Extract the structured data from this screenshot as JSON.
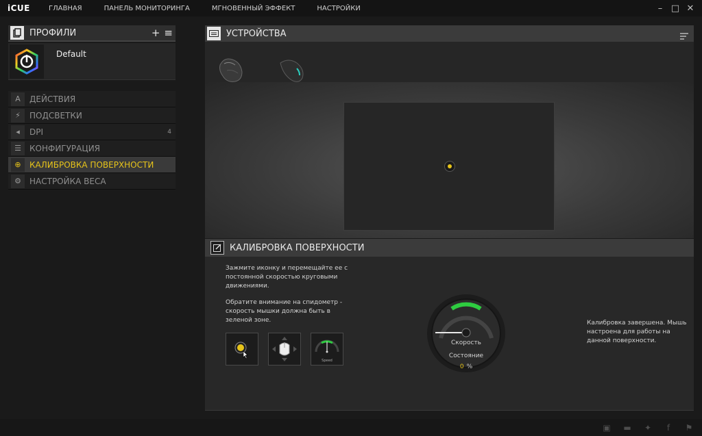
{
  "app": {
    "logo": "iCUE",
    "nav": [
      "ГЛАВНАЯ",
      "ПАНЕЛЬ МОНИТОРИНГА",
      "МГНОВЕННЫЙ ЭФФЕКТ",
      "НАСТРОЙКИ"
    ],
    "window_controls": [
      "minimize-icon",
      "maximize-icon",
      "close-icon"
    ]
  },
  "profiles": {
    "title": "ПРОФИЛИ",
    "add_label": "+",
    "menu_label": "≡",
    "current": {
      "name": "Default",
      "icon": "icue-logo-icon"
    }
  },
  "menu": [
    {
      "label": "ДЕЙСТВИЯ",
      "icon": "A",
      "badge": ""
    },
    {
      "label": "ПОДСВЕТКИ",
      "icon": "⚡",
      "badge": ""
    },
    {
      "label": "DPI",
      "icon": "◂",
      "badge": "4"
    },
    {
      "label": "КОНФИГУРАЦИЯ",
      "icon": "☰",
      "badge": ""
    },
    {
      "label": "КАЛИБРОВКА ПОВЕРХНОСТИ",
      "icon": "⊕",
      "badge": "",
      "active": true
    },
    {
      "label": "НАСТРОЙКА ВЕСА",
      "icon": "⚙",
      "badge": ""
    }
  ],
  "devices": {
    "title": "УСТРОЙСТВА",
    "tabs": [
      "mouse-device-1",
      "mouse-device-2"
    ],
    "active_tab": 0
  },
  "calibration": {
    "title": "КАЛИБРОВКА ПОВЕРХНОСТИ",
    "instructions_1": "Зажмите иконку и перемещайте ее с постоянной скоростью круговыми движениями.",
    "instructions_2": "Обратите внимание на спидометр - скорость мышки должна быть в зеленой зоне.",
    "speed_mini_label": "Speed",
    "gauge_speed_label": "Скорость",
    "gauge_state_label": "Состояние",
    "progress_value": "0",
    "progress_unit": "%",
    "status_message": "Калибровка завершена. Мышь настроена для работы на данной поверхности."
  },
  "colors": {
    "accent": "#e7c41a",
    "gauge_green": "#2ecc40"
  },
  "footer": [
    "chip-icon",
    "chat-icon",
    "twitter-icon",
    "facebook-icon",
    "corsair-icon"
  ]
}
